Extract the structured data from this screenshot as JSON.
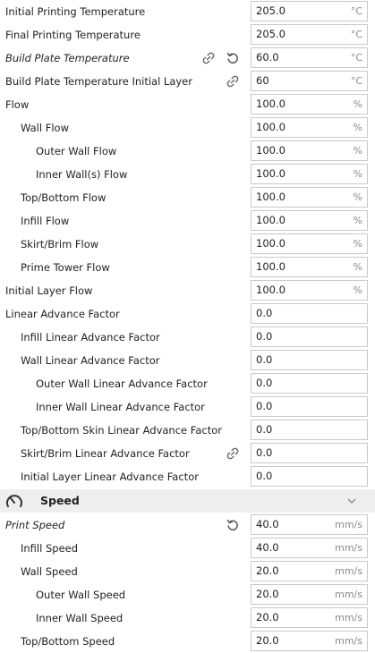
{
  "settings_top": [
    {
      "label": "Initial Printing Temperature",
      "value": "205.0",
      "unit": "°C",
      "indent": 0
    },
    {
      "label": "Final Printing Temperature",
      "value": "205.0",
      "unit": "°C",
      "indent": 0
    },
    {
      "label": "Build Plate Temperature",
      "value": "60.0",
      "unit": "°C",
      "indent": 0,
      "italic": true,
      "link_icon": true,
      "reset_icon": true
    },
    {
      "label": "Build Plate Temperature Initial Layer",
      "value": "60",
      "unit": "°C",
      "indent": 0,
      "link_icon": true
    },
    {
      "label": "Flow",
      "value": "100.0",
      "unit": "%",
      "indent": 0
    },
    {
      "label": "Wall Flow",
      "value": "100.0",
      "unit": "%",
      "indent": 1
    },
    {
      "label": "Outer Wall Flow",
      "value": "100.0",
      "unit": "%",
      "indent": 2
    },
    {
      "label": "Inner Wall(s) Flow",
      "value": "100.0",
      "unit": "%",
      "indent": 2
    },
    {
      "label": "Top/Bottom Flow",
      "value": "100.0",
      "unit": "%",
      "indent": 1
    },
    {
      "label": "Infill Flow",
      "value": "100.0",
      "unit": "%",
      "indent": 1
    },
    {
      "label": "Skirt/Brim Flow",
      "value": "100.0",
      "unit": "%",
      "indent": 1
    },
    {
      "label": "Prime Tower Flow",
      "value": "100.0",
      "unit": "%",
      "indent": 1
    },
    {
      "label": "Initial Layer Flow",
      "value": "100.0",
      "unit": "%",
      "indent": 0
    },
    {
      "label": "Linear Advance Factor",
      "value": "0.0",
      "unit": "",
      "indent": 0
    },
    {
      "label": "Infill Linear Advance Factor",
      "value": "0.0",
      "unit": "",
      "indent": 1
    },
    {
      "label": "Wall Linear Advance Factor",
      "value": "0.0",
      "unit": "",
      "indent": 1
    },
    {
      "label": "Outer Wall Linear Advance Factor",
      "value": "0.0",
      "unit": "",
      "indent": 2
    },
    {
      "label": "Inner Wall Linear Advance Factor",
      "value": "0.0",
      "unit": "",
      "indent": 2
    },
    {
      "label": "Top/Bottom Skin Linear Advance Factor",
      "value": "0.0",
      "unit": "",
      "indent": 1
    },
    {
      "label": "Skirt/Brim Linear Advance Factor",
      "value": "0.0",
      "unit": "",
      "indent": 1,
      "link_icon": true
    },
    {
      "label": "Initial Layer Linear Advance Factor",
      "value": "0.0",
      "unit": "",
      "indent": 1
    }
  ],
  "category": {
    "title": "Speed",
    "icon": "speedometer-icon",
    "chevron": "chevron-down-icon"
  },
  "settings_speed": [
    {
      "label": "Print Speed",
      "value": "40.0",
      "unit": "mm/s",
      "indent": 0,
      "italic": true,
      "reset_icon": true
    },
    {
      "label": "Infill Speed",
      "value": "40.0",
      "unit": "mm/s",
      "indent": 1
    },
    {
      "label": "Wall Speed",
      "value": "20.0",
      "unit": "mm/s",
      "indent": 1
    },
    {
      "label": "Outer Wall Speed",
      "value": "20.0",
      "unit": "mm/s",
      "indent": 2
    },
    {
      "label": "Inner Wall Speed",
      "value": "20.0",
      "unit": "mm/s",
      "indent": 2
    },
    {
      "label": "Top/Bottom Speed",
      "value": "20.0",
      "unit": "mm/s",
      "indent": 1
    }
  ]
}
